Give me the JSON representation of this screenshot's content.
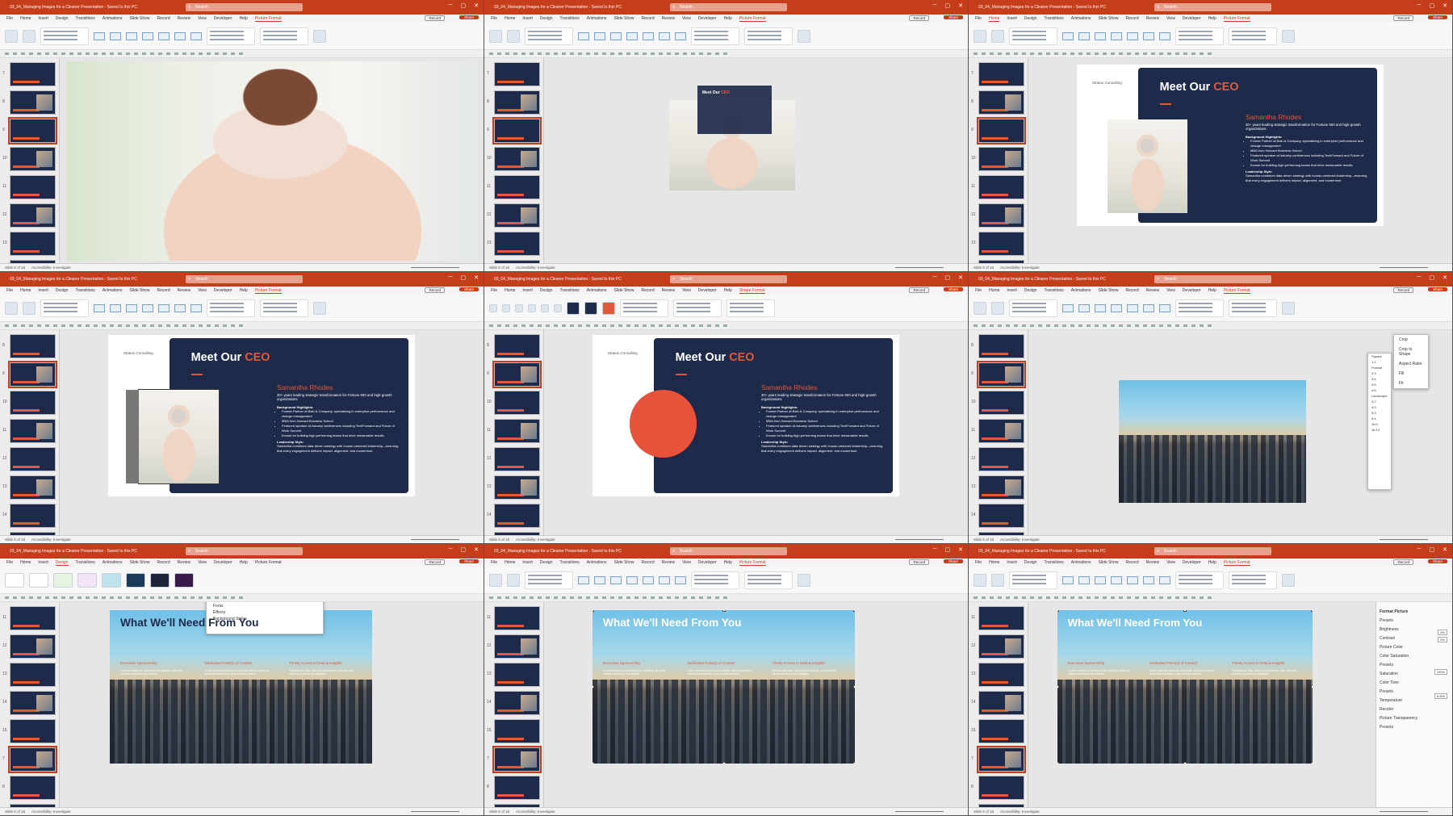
{
  "app": {
    "window_title": "03_04_Managing Images for a Cleaner Presentation - Saved to this PC",
    "search_placeholder": "Search",
    "record_label": "Record",
    "share_label": "Share",
    "status_left": "Slide 8 of 16",
    "accessibility": "Accessibility: Investigate",
    "notes": "Notes"
  },
  "ribbon_tabs": [
    "File",
    "Home",
    "Insert",
    "Design",
    "Transitions",
    "Animations",
    "Slide Show",
    "Record",
    "Review",
    "View",
    "Developer",
    "Help",
    "Picture Format"
  ],
  "ribbon_tabs_shape": [
    "File",
    "Home",
    "Insert",
    "Design",
    "Transitions",
    "Animations",
    "Slide Show",
    "Record",
    "Review",
    "View",
    "Developer",
    "Help",
    "Shape Format"
  ],
  "slide": {
    "company": "Stratus Consulting",
    "meet": "Meet Our",
    "ceo": "CEO",
    "name": "Samantha Rhodes",
    "tagline": "30+ years leading strategic transformation for Fortune 500 and high-growth organizations",
    "bg_head": "Background Highlights:",
    "bullets": [
      "Former Partner at Bain & Company, specializing in enterprise performance and change management",
      "MBA from Harvard Business School",
      "Featured speaker at industry conferences including TechForward and Future of Work Summit",
      "Known for building high-performing teams that drive measurable results"
    ],
    "lead_head": "Leadership Style:",
    "lead_text": "Samantha combines data-driven strategy with human-centered leadership—ensuring that every engagement delivers impact, alignment, and momentum."
  },
  "need": {
    "title": "What We'll Need From You",
    "cols": [
      {
        "h": "Executive Sponsorship",
        "t": "A senior leader to champion the initiative and help unblock decisions as needed."
      },
      {
        "h": "Dedicated Point(s) of Contact",
        "t": "A key internal liaison to coordinate access to teams, schedule interviews, and provide context."
      },
      {
        "h": "Timely Access to Data & Insights",
        "t": "Operational data, process documents, and relevant reports to inform our analysis."
      }
    ]
  },
  "crop_menu": {
    "items": [
      "Crop",
      "Crop to Shape",
      "Aspect Ratio",
      "Fill",
      "Fit"
    ],
    "ratios_square": "Square",
    "ratio_1": "1:1",
    "portrait": "Portrait",
    "portrait_ratios": [
      "2:3",
      "3:4",
      "3:5",
      "4:5"
    ],
    "landscape": "Landscape",
    "landscape_ratios": [
      "3:2",
      "4:3",
      "5:3",
      "5:4",
      "16:9",
      "16:10"
    ]
  },
  "design_menu": {
    "items": [
      "Colors",
      "Fonts",
      "Effects",
      "Background Styles"
    ]
  },
  "format_pane": {
    "title": "Format Picture",
    "rows": [
      "Presets",
      "Brightness",
      "Contrast",
      "Picture Color",
      "Color Saturation",
      "Presets",
      "Saturation",
      "Color Tone",
      "Presets",
      "Temperature",
      "Recolor",
      "Picture Transparency",
      "Presets"
    ],
    "bright_val": "0%",
    "contrast_val": "0%",
    "sat_val": "100%",
    "temp_val": "6,500"
  },
  "thumb_numbers": [
    "7",
    "8",
    "9",
    "10",
    "11",
    "12",
    "13",
    "14",
    "15"
  ]
}
